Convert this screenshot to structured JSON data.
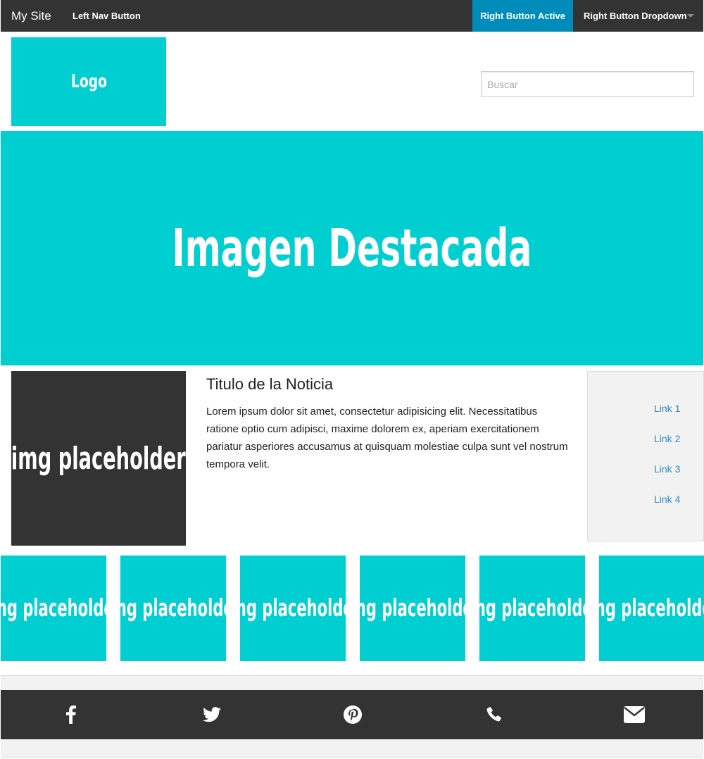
{
  "topbar": {
    "brand": "My Site",
    "left_nav": "Left Nav Button",
    "right_active": "Right Button Active",
    "right_dropdown": "Right Button Dropdown",
    "caret_icon": "chevron-down-icon"
  },
  "header": {
    "logo_text": "Logo",
    "search_placeholder": "Buscar",
    "search_value": ""
  },
  "hero": {
    "text": "Imagen Destacada"
  },
  "article": {
    "image_text": "img placeholder",
    "title": "Titulo de la Noticia",
    "body": "Lorem ipsum dolor sit amet, consectetur adipisicing elit. Necessitatibus ratione optio cum adipisci, maxime dolorem ex, aperiam exercitationem pariatur asperiores accusamus at quisquam molestiae culpa sunt vel nostrum tempora velit."
  },
  "sidebar": {
    "links": [
      "Link 1",
      "Link 2",
      "Link 3",
      "Link 4"
    ]
  },
  "thumbnails": [
    "img placeholder",
    "img placeholder",
    "img placeholder",
    "img placeholder",
    "img placeholder",
    "img placeholder"
  ],
  "footer": {
    "icons": [
      "facebook-icon",
      "twitter-icon",
      "pinterest-icon",
      "phone-icon",
      "envelope-icon"
    ]
  },
  "colors": {
    "topbar_bg": "#333333",
    "active_bg": "#008cba",
    "accent": "#00ced1",
    "link": "#2a8ac0",
    "sidebar_bg": "#f2f2f2"
  }
}
